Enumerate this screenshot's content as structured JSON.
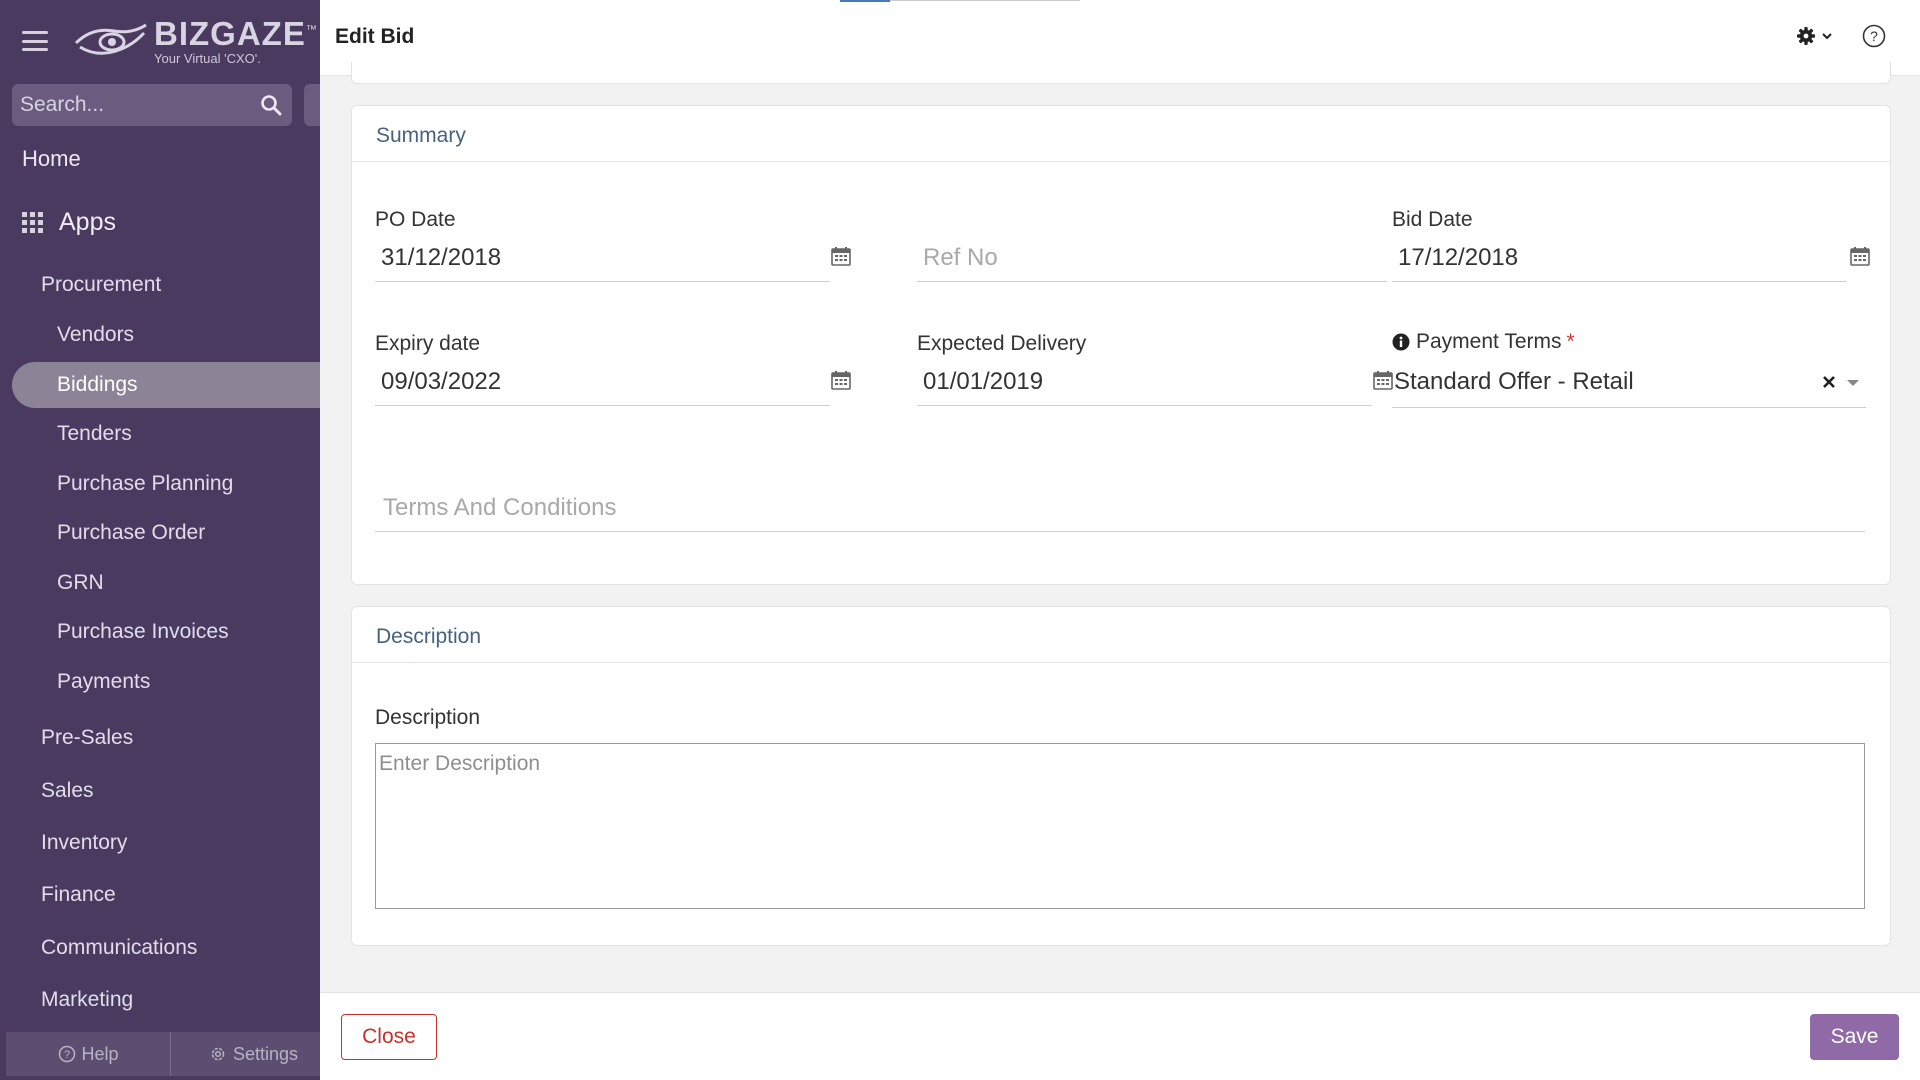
{
  "sidebar": {
    "brand": "BIZGAZE",
    "brand_tm": "™",
    "tagline": "Your Virtual 'CXO'.",
    "search_placeholder": "Search...",
    "home_label": "Home",
    "apps_label": "Apps",
    "procurement_label": "Procurement",
    "procurement_items": [
      "Vendors",
      "Biddings",
      "Tenders",
      "Purchase Planning",
      "Purchase Order",
      "GRN",
      "Purchase Invoices",
      "Payments"
    ],
    "active_item": "Biddings",
    "sections": [
      "Pre-Sales",
      "Sales",
      "Inventory",
      "Finance",
      "Communications",
      "Marketing"
    ],
    "footer": {
      "help_label": "Help",
      "settings_label": "Settings"
    }
  },
  "header": {
    "title": "Edit Bid",
    "settings_icon": "gear-icon",
    "help_icon": "help-circle-icon"
  },
  "summary": {
    "section_title": "Summary",
    "po_date": {
      "label": "PO Date",
      "value": "31/12/2018"
    },
    "ref_no": {
      "placeholder": "Ref No",
      "value": ""
    },
    "bid_date": {
      "label": "Bid Date",
      "value": "17/12/2018"
    },
    "expiry_date": {
      "label": "Expiry date",
      "value": "09/03/2022"
    },
    "expected_delivery": {
      "label": "Expected Delivery",
      "value": "01/01/2019"
    },
    "payment_terms": {
      "label": "Payment Terms",
      "required_mark": "*",
      "value": "Standard Offer - Retail"
    },
    "terms_and_conditions": {
      "placeholder": "Terms And Conditions",
      "value": ""
    }
  },
  "description": {
    "section_title": "Description",
    "label": "Description",
    "placeholder": "Enter Description",
    "value": ""
  },
  "footer": {
    "close_label": "Close",
    "save_label": "Save"
  },
  "colors": {
    "sidebar_bg": "#4a3a60",
    "active_item_bg": "#8d8396",
    "section_title": "#46637e",
    "close_red": "#c9302c",
    "save_purple": "#8f6aa7",
    "required_red": "#d9342b"
  }
}
